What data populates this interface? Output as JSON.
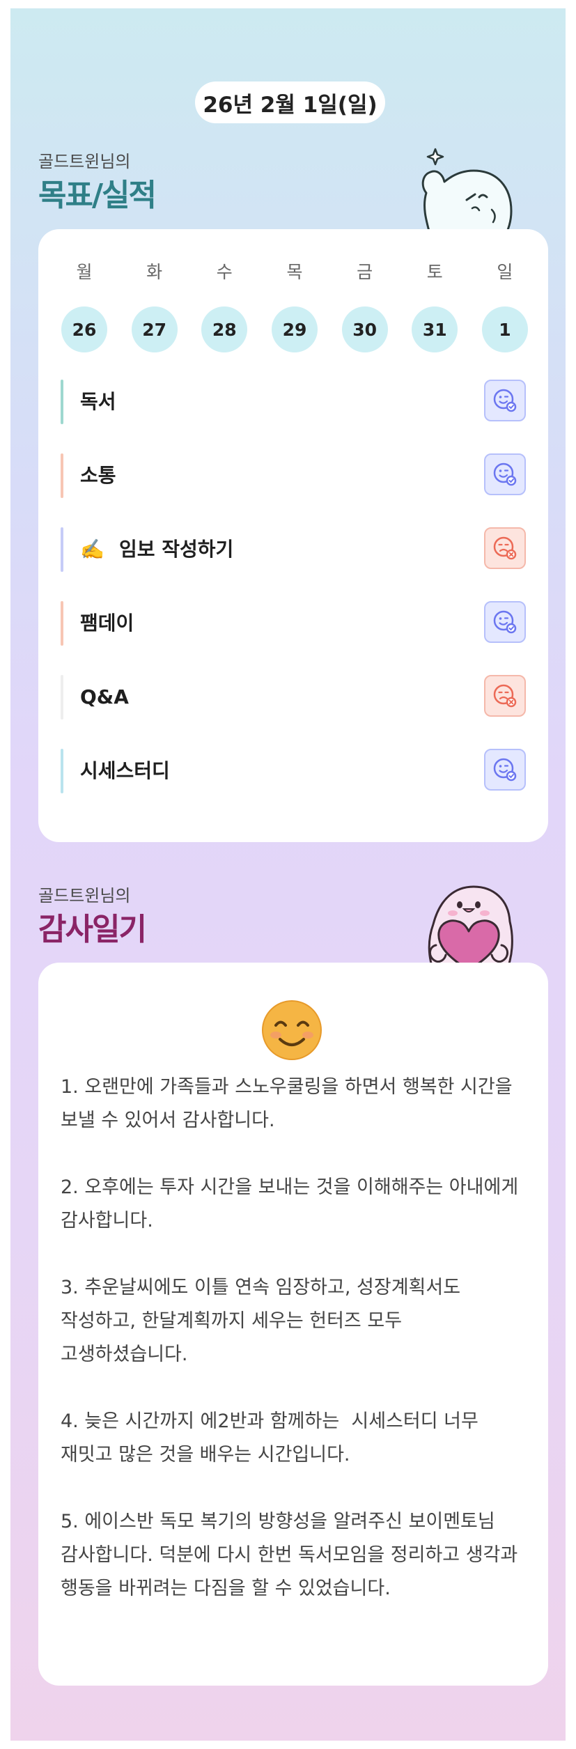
{
  "header": {
    "date": "26년 2월 1일(일)"
  },
  "goals_section": {
    "owner": "골드트윈님의",
    "title": "목표/실적"
  },
  "week": [
    {
      "day": "월",
      "date": "26"
    },
    {
      "day": "화",
      "date": "27"
    },
    {
      "day": "수",
      "date": "28"
    },
    {
      "day": "목",
      "date": "29"
    },
    {
      "day": "금",
      "date": "30"
    },
    {
      "day": "토",
      "date": "31"
    },
    {
      "day": "일",
      "date": "1"
    }
  ],
  "goals": [
    {
      "label": "독서",
      "emoji": "",
      "status": "done",
      "bar_color": "#9ed8cf"
    },
    {
      "label": "소통",
      "emoji": "",
      "status": "done",
      "bar_color": "#f7c6b4"
    },
    {
      "label": "임보 작성하기",
      "emoji": "✍️",
      "status": "missed",
      "bar_color": "#c6ccf7"
    },
    {
      "label": "팸데이",
      "emoji": "",
      "status": "done",
      "bar_color": "#f7c6b4"
    },
    {
      "label": "Q&A",
      "emoji": "",
      "status": "missed",
      "bar_color": "#eeeeee"
    },
    {
      "label": "시세스터디",
      "emoji": "",
      "status": "done",
      "bar_color": "#b9e3ee"
    }
  ],
  "gratitude_section": {
    "owner": "골드트윈님의",
    "title": "감사일기",
    "entries": [
      "1. 오랜만에 가족들과 스노우쿨링을 하면서 행복한 시간을 보낼 수 있어서 감사합니다.",
      "2. 오후에는 투자 시간을 보내는 것을 이해해주는 아내에게 감사합니다.",
      "3. 추운날씨에도 이틀 연속 임장하고, 성장계획서도 작성하고, 한달계획까지 세우는 헌터즈 모두 고생하셨습니다.",
      "4. 늦은 시간까지 에2반과 함께하는  시세스터디 너무 재밋고 많은 것을 배우는 시간입니다.",
      "5. 에이스반 독모 복기의 방향성을 알려주신 보이멘토님 감사합니다. 덕분에 다시 한번 독서모임을 정리하고 생각과 행동을 바뀌려는 다짐을 할 수 있었습니다."
    ]
  },
  "colors": {
    "goals_title": "#2f7f87",
    "gratitude_title": "#8a2466",
    "done": "#6b76f0",
    "missed": "#ec6a56",
    "date_circle": "#cdeff4"
  },
  "icons": {
    "done": "smile-check-icon",
    "missed": "sad-x-icon",
    "gratitude": "smiling-face-icon"
  }
}
